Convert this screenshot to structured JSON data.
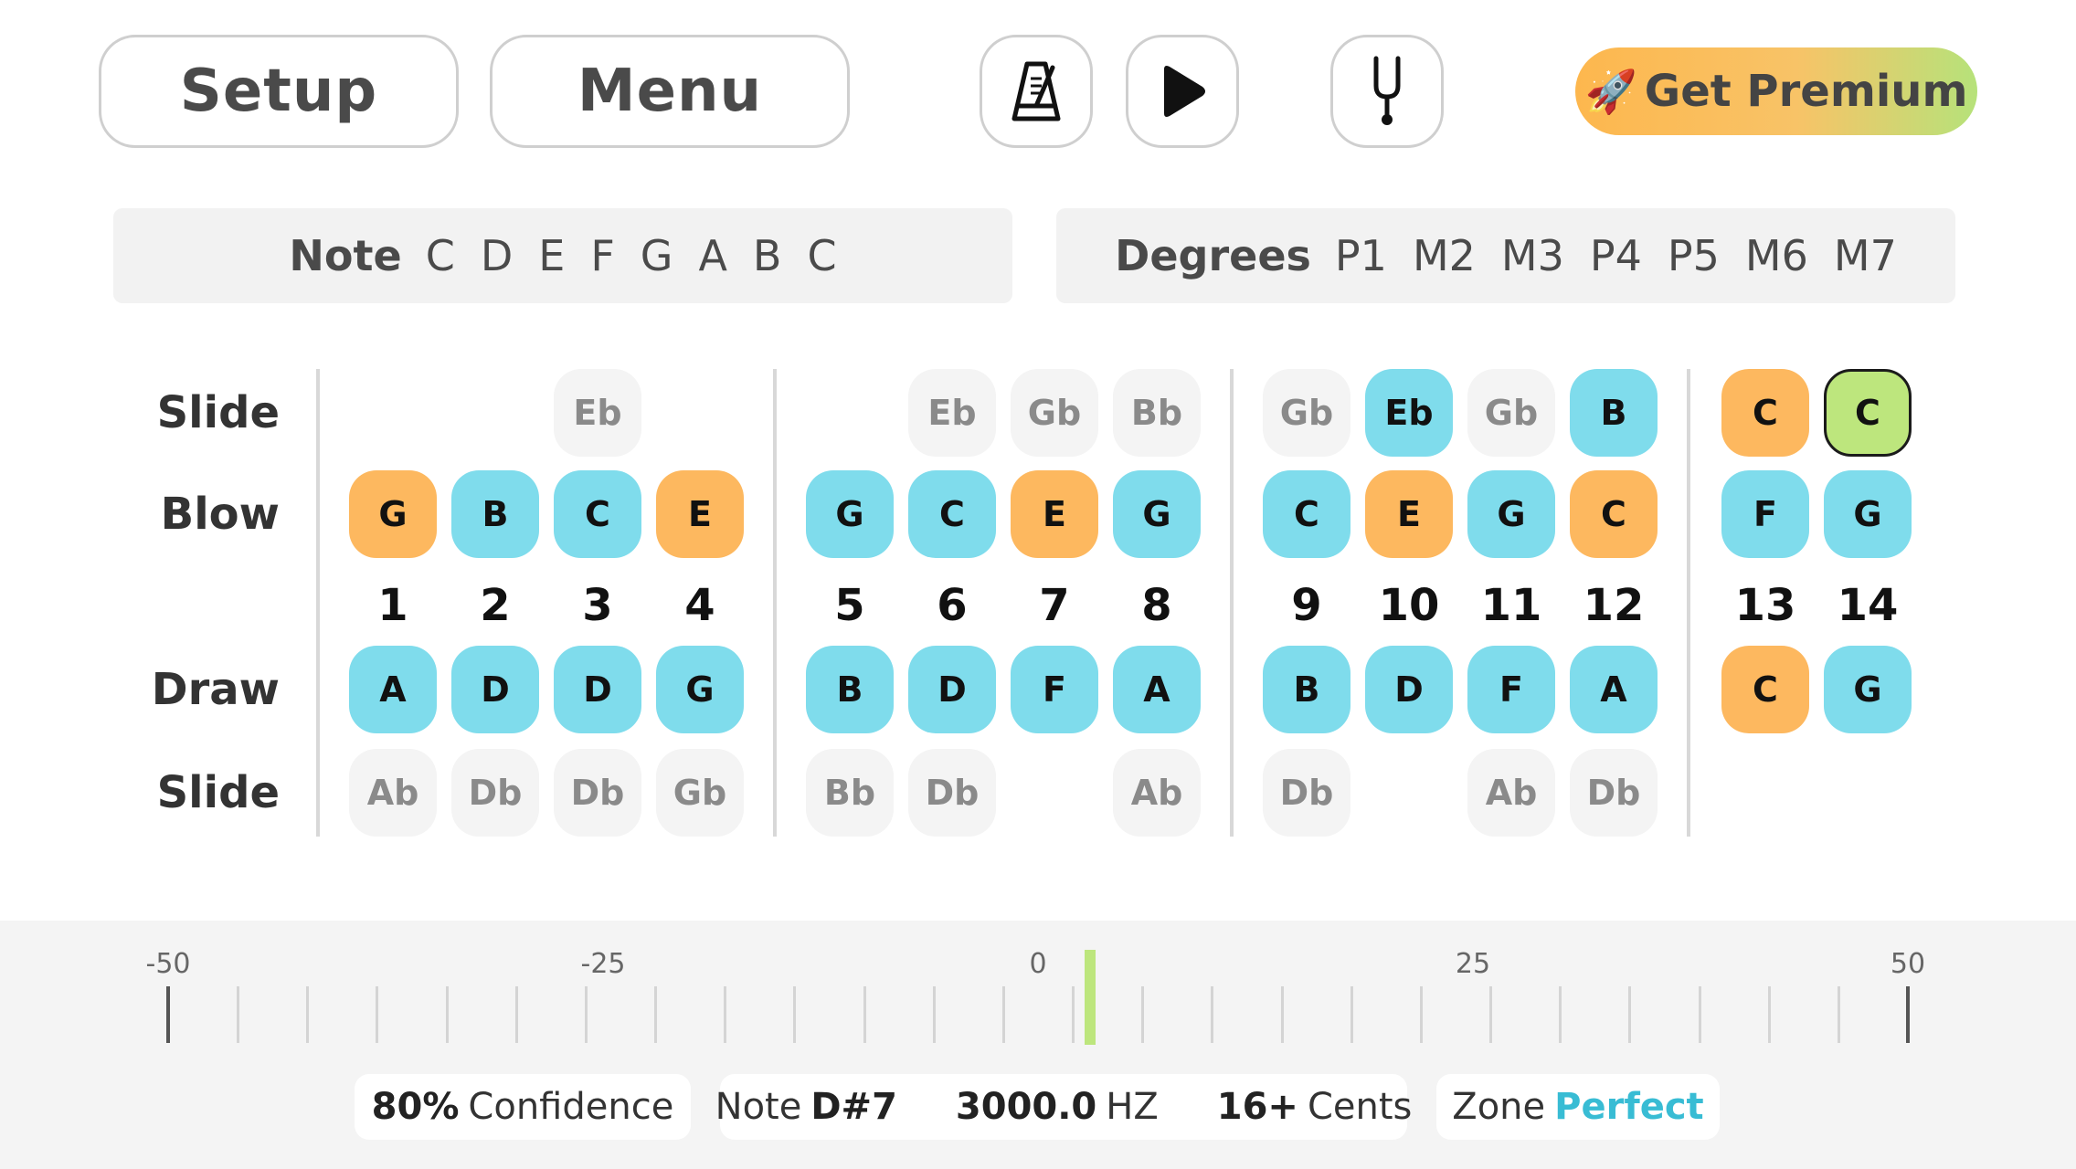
{
  "toolbar": {
    "setup_label": "Setup",
    "menu_label": "Menu",
    "metronome_icon": "metronome-icon",
    "play_icon": "play-icon",
    "tuning_fork_icon": "tuning-fork-icon",
    "premium_icon": "🚀",
    "premium_label": "Get Premium"
  },
  "note_strip": {
    "label": "Note",
    "notes": [
      "C",
      "D",
      "E",
      "F",
      "G",
      "A",
      "B",
      "C"
    ]
  },
  "degree_strip": {
    "label": "Degrees",
    "degrees": [
      "P1",
      "M2",
      "M3",
      "P4",
      "P5",
      "M6",
      "M7"
    ]
  },
  "harmonica": {
    "row_labels": {
      "slide_top": "Slide",
      "blow": "Blow",
      "draw": "Draw",
      "slide_bottom": "Slide"
    },
    "holes": [
      {
        "n": "1",
        "slide_top": null,
        "blow": "G",
        "draw": "A",
        "slide_bottom": "Ab",
        "blow_color": "orange",
        "draw_color": "blue"
      },
      {
        "n": "2",
        "slide_top": null,
        "blow": "B",
        "draw": "D",
        "slide_bottom": "Db",
        "blow_color": "blue",
        "draw_color": "blue"
      },
      {
        "n": "3",
        "slide_top": "Eb",
        "blow": "C",
        "draw": "D",
        "slide_bottom": "Db",
        "blow_color": "blue",
        "draw_color": "blue"
      },
      {
        "n": "4",
        "slide_top": null,
        "blow": "E",
        "draw": "G",
        "slide_bottom": "Gb",
        "blow_color": "orange",
        "draw_color": "blue"
      },
      {
        "n": "5",
        "slide_top": null,
        "blow": "G",
        "draw": "B",
        "slide_bottom": "Bb",
        "blow_color": "blue",
        "draw_color": "blue"
      },
      {
        "n": "6",
        "slide_top": "Eb",
        "blow": "C",
        "draw": "D",
        "slide_bottom": "Db",
        "blow_color": "blue",
        "draw_color": "blue"
      },
      {
        "n": "7",
        "slide_top": "Gb",
        "blow": "E",
        "draw": "F",
        "slide_bottom": null,
        "blow_color": "orange",
        "draw_color": "blue"
      },
      {
        "n": "8",
        "slide_top": "Bb",
        "blow": "G",
        "draw": "A",
        "slide_bottom": "Ab",
        "blow_color": "blue",
        "draw_color": "blue"
      },
      {
        "n": "9",
        "slide_top": "Gb",
        "blow": "C",
        "draw": "B",
        "slide_bottom": "Db",
        "blow_color": "blue",
        "draw_color": "blue"
      },
      {
        "n": "10",
        "slide_top": "Eb",
        "blow": "E",
        "draw": "D",
        "slide_bottom": null,
        "blow_color": "orange",
        "draw_color": "blue",
        "slide_top_color": "blue"
      },
      {
        "n": "11",
        "slide_top": "Gb",
        "blow": "G",
        "draw": "F",
        "slide_bottom": "Ab",
        "blow_color": "blue",
        "draw_color": "blue"
      },
      {
        "n": "12",
        "slide_top": "B",
        "blow": "C",
        "draw": "A",
        "slide_bottom": "Db",
        "blow_color": "orange",
        "draw_color": "blue",
        "slide_top_color": "blue"
      },
      {
        "n": "13",
        "slide_top": "C",
        "blow": "F",
        "draw": "C",
        "slide_bottom": null,
        "blow_color": "blue",
        "draw_color": "orange",
        "slide_top_color": "orange"
      },
      {
        "n": "14",
        "slide_top": "C",
        "blow": "G",
        "draw": "G",
        "slide_bottom": null,
        "blow_color": "blue",
        "draw_color": "blue",
        "slide_top_color": "green"
      }
    ]
  },
  "tuner": {
    "scale_labels": [
      "-50",
      "-25",
      "0",
      "25",
      "50"
    ],
    "cents_min": -50,
    "cents_max": 50,
    "needle_cents": 3,
    "confidence_value": "80%",
    "confidence_label": "Confidence",
    "note_label": "Note",
    "note_value": "D#7",
    "hz_value": "3000.0",
    "hz_unit": "HZ",
    "cents_value": "16+",
    "cents_label": "Cents",
    "zone_label": "Zone",
    "zone_value": "Perfect"
  }
}
